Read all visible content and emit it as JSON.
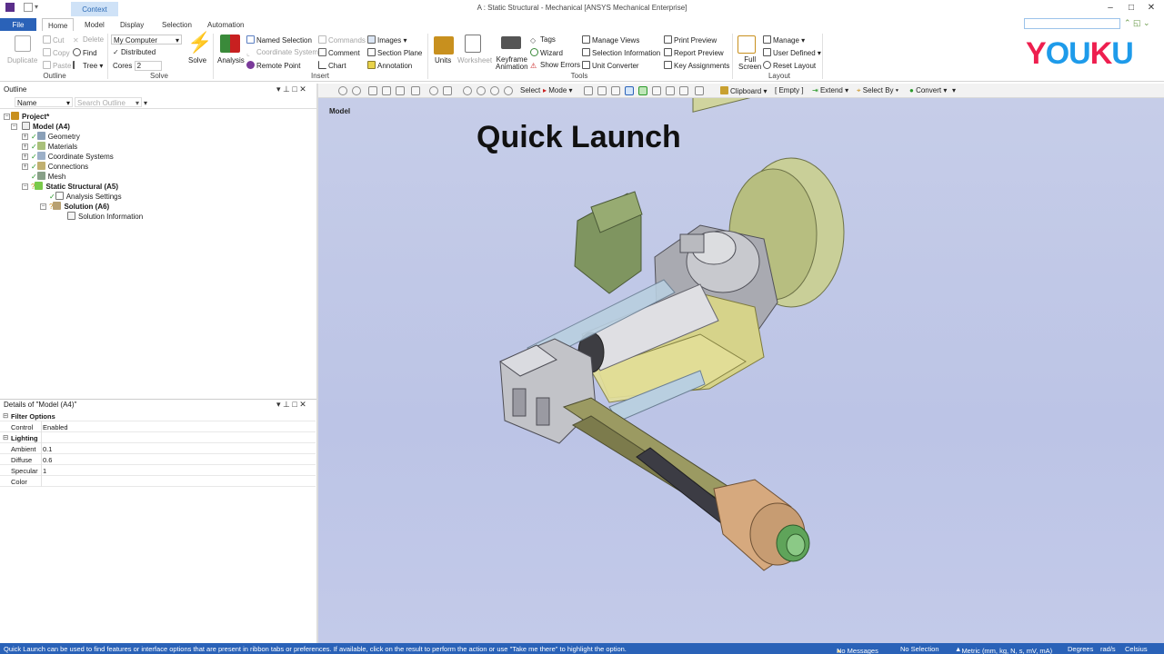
{
  "window": {
    "title": "A : Static Structural - Mechanical [ANSYS Mechanical Enterprise]",
    "context_tab": "Context"
  },
  "tabs": [
    "File",
    "Home",
    "Model",
    "Display",
    "Selection",
    "Automation"
  ],
  "watermark": "YOUKU",
  "ribbon": {
    "outline": {
      "duplicate": "Duplicate",
      "cut": "Cut",
      "copy": "Copy",
      "paste": "Paste",
      "delete": "Delete",
      "find": "Find",
      "tree": "Tree",
      "group": "Outline"
    },
    "solve": {
      "machine": "My Computer",
      "distributed": "Distributed",
      "cores_label": "Cores",
      "cores_value": "2",
      "solve": "Solve",
      "group": "Solve"
    },
    "insert": {
      "analysis": "Analysis",
      "named_selection": "Named Selection",
      "coordinate_system": "Coordinate System",
      "remote_point": "Remote Point",
      "commands": "Commands",
      "comment": "Comment",
      "chart": "Chart",
      "images": "Images",
      "section_plane": "Section Plane",
      "annotation": "Annotation",
      "group": "Insert"
    },
    "tools": {
      "units": "Units",
      "worksheet": "Worksheet",
      "keyframe_animation": [
        "Keyframe",
        "Animation"
      ],
      "tags": "Tags",
      "wizard": "Wizard",
      "show_errors": "Show Errors",
      "manage_views": "Manage Views",
      "selection_information": "Selection Information",
      "unit_converter": "Unit Converter",
      "print_preview": "Print Preview",
      "report_preview": "Report Preview",
      "key_assignments": "Key Assignments",
      "group": "Tools"
    },
    "layout": {
      "full_screen": [
        "Full",
        "Screen"
      ],
      "manage": "Manage",
      "user_defined": "User Defined",
      "reset_layout": "Reset Layout",
      "group": "Layout"
    }
  },
  "graphics_toolbar": {
    "select": "Select",
    "mode": "Mode",
    "clipboard": "Clipboard",
    "empty": "[ Empty ]",
    "extend": "Extend",
    "select_by": "Select By",
    "convert": "Convert"
  },
  "outline": {
    "title": "Outline",
    "col_name": "Name",
    "search_placeholder": "Search Outline",
    "nodes": [
      {
        "label": "Project*",
        "bold": true
      },
      {
        "label": "Model (A4)",
        "bold": true
      },
      {
        "label": "Geometry"
      },
      {
        "label": "Materials"
      },
      {
        "label": "Coordinate Systems"
      },
      {
        "label": "Connections"
      },
      {
        "label": "Mesh"
      },
      {
        "label": "Static Structural (A5)",
        "bold": true
      },
      {
        "label": "Analysis Settings"
      },
      {
        "label": "Solution (A6)",
        "bold": true
      },
      {
        "label": "Solution Information"
      }
    ]
  },
  "details": {
    "title": "Details of \"Model (A4)\"",
    "rows": [
      {
        "k": "Filter Options",
        "v": "",
        "cat": true
      },
      {
        "k": "Control",
        "v": "Enabled"
      },
      {
        "k": "Lighting",
        "v": "",
        "cat": true
      },
      {
        "k": "Ambient",
        "v": "0.1"
      },
      {
        "k": "Diffuse",
        "v": "0.6"
      },
      {
        "k": "Specular",
        "v": "1"
      },
      {
        "k": "Color",
        "v": ""
      }
    ]
  },
  "graphics": {
    "label": "Model",
    "headline": "Quick Launch"
  },
  "status": {
    "message": "Quick Launch can be used to find features or interface options that are present in ribbon tabs or preferences. If available, click on the result to perform the action or use \"Take me there\" to highlight the option.",
    "messages": "No Messages",
    "selection": "No Selection",
    "units": "Metric (mm, kg, N, s, mV, mA)",
    "angle": "Degrees",
    "angular_velocity": "rad/s",
    "temperature": "Celsius"
  }
}
